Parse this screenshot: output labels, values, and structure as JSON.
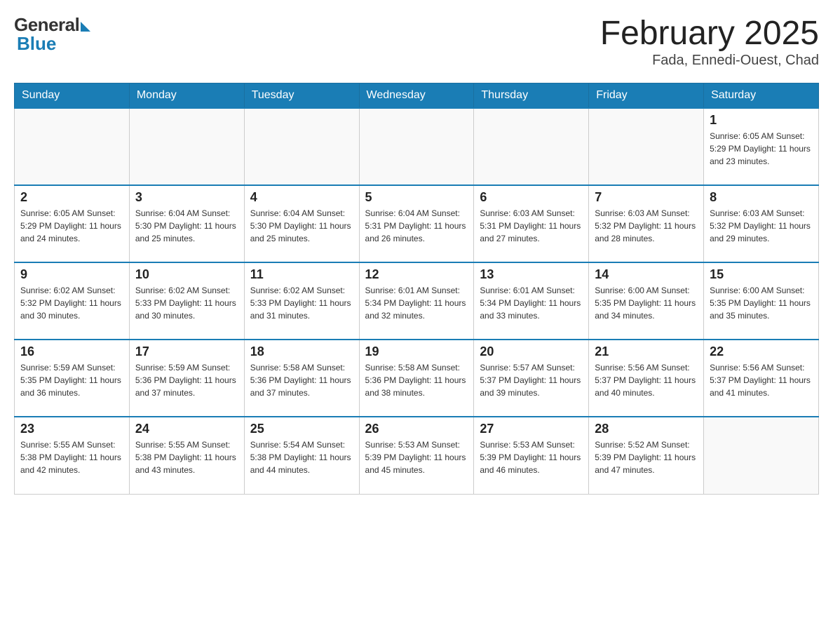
{
  "header": {
    "logo_general": "General",
    "logo_blue": "Blue",
    "month_title": "February 2025",
    "location": "Fada, Ennedi-Ouest, Chad"
  },
  "weekdays": [
    "Sunday",
    "Monday",
    "Tuesday",
    "Wednesday",
    "Thursday",
    "Friday",
    "Saturday"
  ],
  "weeks": [
    [
      {
        "day": "",
        "info": ""
      },
      {
        "day": "",
        "info": ""
      },
      {
        "day": "",
        "info": ""
      },
      {
        "day": "",
        "info": ""
      },
      {
        "day": "",
        "info": ""
      },
      {
        "day": "",
        "info": ""
      },
      {
        "day": "1",
        "info": "Sunrise: 6:05 AM\nSunset: 5:29 PM\nDaylight: 11 hours\nand 23 minutes."
      }
    ],
    [
      {
        "day": "2",
        "info": "Sunrise: 6:05 AM\nSunset: 5:29 PM\nDaylight: 11 hours\nand 24 minutes."
      },
      {
        "day": "3",
        "info": "Sunrise: 6:04 AM\nSunset: 5:30 PM\nDaylight: 11 hours\nand 25 minutes."
      },
      {
        "day": "4",
        "info": "Sunrise: 6:04 AM\nSunset: 5:30 PM\nDaylight: 11 hours\nand 25 minutes."
      },
      {
        "day": "5",
        "info": "Sunrise: 6:04 AM\nSunset: 5:31 PM\nDaylight: 11 hours\nand 26 minutes."
      },
      {
        "day": "6",
        "info": "Sunrise: 6:03 AM\nSunset: 5:31 PM\nDaylight: 11 hours\nand 27 minutes."
      },
      {
        "day": "7",
        "info": "Sunrise: 6:03 AM\nSunset: 5:32 PM\nDaylight: 11 hours\nand 28 minutes."
      },
      {
        "day": "8",
        "info": "Sunrise: 6:03 AM\nSunset: 5:32 PM\nDaylight: 11 hours\nand 29 minutes."
      }
    ],
    [
      {
        "day": "9",
        "info": "Sunrise: 6:02 AM\nSunset: 5:32 PM\nDaylight: 11 hours\nand 30 minutes."
      },
      {
        "day": "10",
        "info": "Sunrise: 6:02 AM\nSunset: 5:33 PM\nDaylight: 11 hours\nand 30 minutes."
      },
      {
        "day": "11",
        "info": "Sunrise: 6:02 AM\nSunset: 5:33 PM\nDaylight: 11 hours\nand 31 minutes."
      },
      {
        "day": "12",
        "info": "Sunrise: 6:01 AM\nSunset: 5:34 PM\nDaylight: 11 hours\nand 32 minutes."
      },
      {
        "day": "13",
        "info": "Sunrise: 6:01 AM\nSunset: 5:34 PM\nDaylight: 11 hours\nand 33 minutes."
      },
      {
        "day": "14",
        "info": "Sunrise: 6:00 AM\nSunset: 5:35 PM\nDaylight: 11 hours\nand 34 minutes."
      },
      {
        "day": "15",
        "info": "Sunrise: 6:00 AM\nSunset: 5:35 PM\nDaylight: 11 hours\nand 35 minutes."
      }
    ],
    [
      {
        "day": "16",
        "info": "Sunrise: 5:59 AM\nSunset: 5:35 PM\nDaylight: 11 hours\nand 36 minutes."
      },
      {
        "day": "17",
        "info": "Sunrise: 5:59 AM\nSunset: 5:36 PM\nDaylight: 11 hours\nand 37 minutes."
      },
      {
        "day": "18",
        "info": "Sunrise: 5:58 AM\nSunset: 5:36 PM\nDaylight: 11 hours\nand 37 minutes."
      },
      {
        "day": "19",
        "info": "Sunrise: 5:58 AM\nSunset: 5:36 PM\nDaylight: 11 hours\nand 38 minutes."
      },
      {
        "day": "20",
        "info": "Sunrise: 5:57 AM\nSunset: 5:37 PM\nDaylight: 11 hours\nand 39 minutes."
      },
      {
        "day": "21",
        "info": "Sunrise: 5:56 AM\nSunset: 5:37 PM\nDaylight: 11 hours\nand 40 minutes."
      },
      {
        "day": "22",
        "info": "Sunrise: 5:56 AM\nSunset: 5:37 PM\nDaylight: 11 hours\nand 41 minutes."
      }
    ],
    [
      {
        "day": "23",
        "info": "Sunrise: 5:55 AM\nSunset: 5:38 PM\nDaylight: 11 hours\nand 42 minutes."
      },
      {
        "day": "24",
        "info": "Sunrise: 5:55 AM\nSunset: 5:38 PM\nDaylight: 11 hours\nand 43 minutes."
      },
      {
        "day": "25",
        "info": "Sunrise: 5:54 AM\nSunset: 5:38 PM\nDaylight: 11 hours\nand 44 minutes."
      },
      {
        "day": "26",
        "info": "Sunrise: 5:53 AM\nSunset: 5:39 PM\nDaylight: 11 hours\nand 45 minutes."
      },
      {
        "day": "27",
        "info": "Sunrise: 5:53 AM\nSunset: 5:39 PM\nDaylight: 11 hours\nand 46 minutes."
      },
      {
        "day": "28",
        "info": "Sunrise: 5:52 AM\nSunset: 5:39 PM\nDaylight: 11 hours\nand 47 minutes."
      },
      {
        "day": "",
        "info": ""
      }
    ]
  ],
  "accent_color": "#1a7db5"
}
